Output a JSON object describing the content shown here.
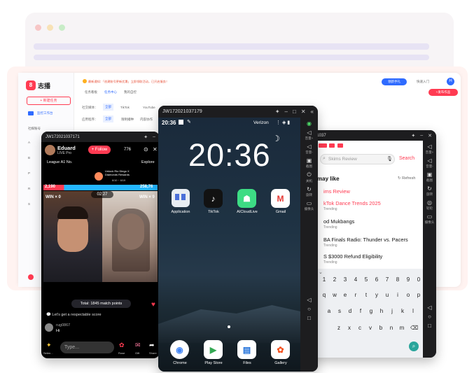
{
  "colors": {
    "accent": "#ff3b52",
    "link": "#2f6bff",
    "dark": "#1d1d1f"
  },
  "app": {
    "logo_text": "志播",
    "new_task": "+ 新建任务",
    "sidebar_items": [
      "监控工作台",
      "社媒账号",
      "A",
      "B",
      "P",
      "R",
      "S"
    ],
    "notice": "最新通知：「创建账号更新优惠」立即领取活动，已开启服务！",
    "top_btn_1": "领新手礼",
    "top_btn_2": "快速入门",
    "avatar": "H",
    "cta": "+发布作品",
    "tabs": [
      "任务看板",
      "任务中心",
      "我的自控"
    ],
    "filter_platform_label": "社交媒体：",
    "filter_platform_values": [
      "全部",
      "TikTok",
      "YouTube"
    ],
    "filter_type_label": "应用程序：",
    "filter_type_values": [
      "全部",
      "限制播种",
      "内容协作"
    ]
  },
  "left_phone": {
    "id": "JW172021037171",
    "user": "Eduard",
    "user_sub": "LIVE Pro",
    "follow": "+ Follow",
    "viewers": "776",
    "league": "League A1 No.",
    "promo": "Unlock Rio Diego X Diamonds Rewards",
    "promo_date": "6/10 ~ 6/19",
    "explore": "Explore",
    "score_left": "2,190",
    "score_right": "258,76",
    "timer": "02:27",
    "win_left": "WIN × 0",
    "win_right": "WIN × 9",
    "total": "Total: 1845 match points",
    "comment1": "Let's get a respectable score",
    "comment_user": "rug0867",
    "comment_text": "Hi",
    "type_placeholder": "Type...",
    "bottom_labels": [
      "Selen...",
      "Rose",
      "Gift",
      "Share"
    ]
  },
  "center_phone": {
    "id": "JW172021037179",
    "time": "20:36",
    "carrier": "Verizon",
    "clock": "20:36",
    "apps": [
      {
        "label": "Application",
        "icon": "application-icon"
      },
      {
        "label": "TikTok",
        "icon": "tiktok-icon"
      },
      {
        "label": "AICloudLive",
        "icon": "android-icon"
      },
      {
        "label": "Gmail",
        "icon": "gmail-icon"
      }
    ],
    "dock": [
      {
        "label": "Chrome",
        "icon": "chrome-icon"
      },
      {
        "label": "Play Store",
        "icon": "play-store-icon"
      },
      {
        "label": "Files",
        "icon": "files-icon"
      },
      {
        "label": "Gallery",
        "icon": "gallery-icon"
      }
    ],
    "rail_labels": [
      "",
      "最近",
      "返回",
      "关机",
      "音量+",
      "音量-",
      "截图",
      "旋转",
      "摄像头"
    ]
  },
  "right_phone": {
    "id": "JW172021037",
    "search_placeholder": "Skims Review",
    "search_btn": "Search",
    "may_like": "may like",
    "refresh": "Refresh",
    "suggestions": [
      {
        "text": "ims Review",
        "sub": "",
        "red": true
      },
      {
        "text": "kTok Dance Trends 2025",
        "sub": "Trending",
        "red": true
      },
      {
        "text": "od Mukbangs",
        "sub": "Trending",
        "red": false
      },
      {
        "text": "BA Finals Radio: Thunder vs. Pacers",
        "sub": "Trending",
        "red": false
      },
      {
        "text": "S $3000 Refund Eligibility",
        "sub": "Trending",
        "red": false
      }
    ],
    "keys_row1": [
      "1",
      "2",
      "3",
      "4",
      "5",
      "6",
      "7",
      "8",
      "9",
      "0"
    ],
    "keys_row2": [
      "q",
      "w",
      "e",
      "r",
      "t",
      "y",
      "u",
      "i",
      "o",
      "p"
    ],
    "keys_row3": [
      "a",
      "s",
      "d",
      "f",
      "g",
      "h",
      "j",
      "k",
      "l"
    ],
    "keys_row4": [
      "z",
      "x",
      "c",
      "v",
      "b",
      "n",
      "m"
    ],
    "rail_labels": [
      "音量+",
      "音量-",
      "截图",
      "旋转",
      "轮轮",
      "摄像头"
    ]
  }
}
